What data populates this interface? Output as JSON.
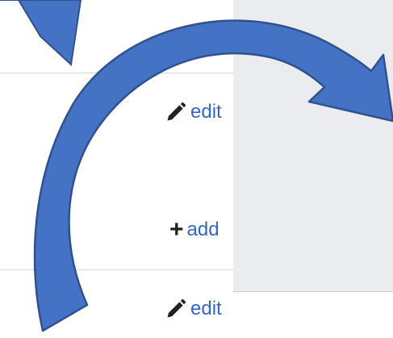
{
  "rows": [
    {
      "icon": "pencil-icon",
      "label": "edit"
    },
    {
      "icon": "plus-icon",
      "label": "add"
    },
    {
      "icon": "pencil-icon",
      "label": "edit"
    }
  ],
  "colors": {
    "link": "#3366cc",
    "icon": "#202122",
    "side_panel": "#eaecf0",
    "arrow_fill": "#4472c4",
    "arrow_stroke": "#2f528f"
  },
  "annotations": {
    "arrow_icon": "curved-arrow-icon",
    "pointer_icon": "down-arrow-icon"
  }
}
